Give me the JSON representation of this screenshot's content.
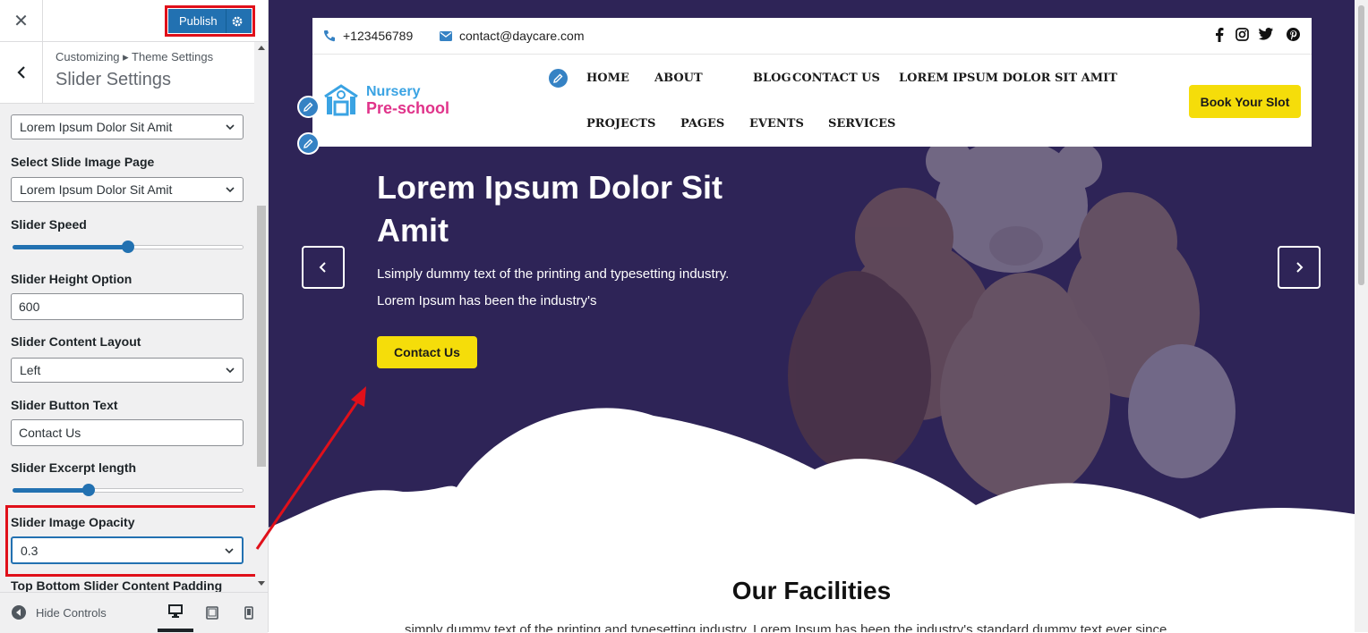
{
  "customizer": {
    "publish_label": "Publish",
    "breadcrumb": "Customizing ▸ Theme Settings",
    "section_title": "Slider Settings",
    "controls": {
      "prev_select_value": "Lorem Ipsum Dolor Sit Amit",
      "slide_image_page_label": "Select Slide Image Page",
      "slide_image_page_value": "Lorem Ipsum Dolor Sit Amit",
      "speed_label": "Slider Speed",
      "speed_level": 0.5,
      "height_option_label": "Slider Height Option",
      "height_option_value": "600",
      "content_layout_label": "Slider Content Layout",
      "content_layout_value": "Left",
      "button_text_label": "Slider Button Text",
      "button_text_value": "Contact Us",
      "excerpt_length_label": "Slider Excerpt length",
      "excerpt_length_level": 0.33,
      "image_opacity_label": "Slider Image Opacity",
      "image_opacity_value": "0.3",
      "padding_label": "Top Bottom Slider Content Padding"
    },
    "footer": {
      "hide_controls": "Hide Controls",
      "devices": [
        "desktop-icon",
        "tablet-icon",
        "mobile-icon"
      ]
    }
  },
  "site": {
    "phone": "+123456789",
    "email": "contact@daycare.com",
    "social": [
      "facebook-icon",
      "instagram-icon",
      "twitter-icon",
      "pinterest-icon"
    ],
    "logo": {
      "line1": "Nursery",
      "line2": "Pre-school"
    },
    "nav_row1": [
      "HOME",
      "ABOUT",
      "BLOG",
      "CONTACT US",
      "LOREM IPSUM DOLOR SIT AMIT"
    ],
    "nav_row2": [
      "PROJECTS",
      "PAGES",
      "EVENTS",
      "SERVICES"
    ],
    "book_button": "Book Your Slot",
    "hero": {
      "title": "Lorem Ipsum Dolor Sit Amit",
      "text_line1": "Lsimply dummy text of the printing and typesetting industry.",
      "text_line2": "Lorem Ipsum has been the industry's",
      "button": "Contact Us"
    },
    "facilities": {
      "title": "Our Facilities",
      "text": "simply dummy text of the printing and typesetting industry. Lorem Ipsum has been the industry's standard dummy text ever since"
    }
  },
  "colors": {
    "accent_blue": "#2271b1",
    "highlight_red": "#e0101a",
    "hero_bg": "#2e2457",
    "yellow": "#f5dd0a",
    "logo_blue": "#3aa3e3",
    "logo_pink": "#e0338a"
  }
}
